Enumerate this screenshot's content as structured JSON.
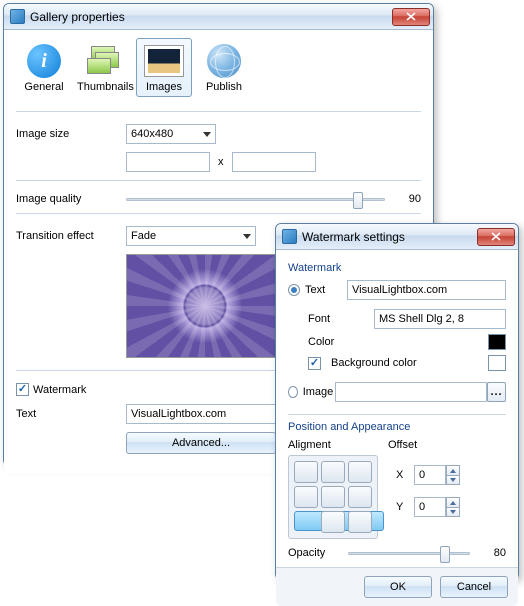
{
  "win1": {
    "title": "Gallery properties",
    "tabs": {
      "general": "General",
      "thumbnails": "Thumbnails",
      "images": "Images",
      "publish": "Publish"
    },
    "image_size_label": "Image size",
    "image_size_value": "640x480",
    "width_value": "",
    "height_value": "",
    "size_sep": "x",
    "quality_label": "Image quality",
    "quality_value": "90",
    "transition_label": "Transition effect",
    "transition_value": "Fade",
    "watermark_label": "Watermark",
    "text_label": "Text",
    "text_value": "VisualLightbox.com",
    "advanced_btn": "Advanced..."
  },
  "win2": {
    "title": "Watermark settings",
    "group_watermark": "Watermark",
    "radio_text": "Text",
    "text_value": "VisualLightbox.com",
    "font_label": "Font",
    "font_value": "MS Shell Dlg 2, 8",
    "color_label": "Color",
    "bgcolor_label": "Background color",
    "radio_image": "Image",
    "image_value": "",
    "group_pos": "Position and Appearance",
    "alignment_label": "Aligment",
    "offset_label": "Offset",
    "x_label": "X",
    "x_value": "0",
    "y_label": "Y",
    "y_value": "0",
    "opacity_label": "Opacity",
    "opacity_value": "80",
    "ok": "OK",
    "cancel": "Cancel",
    "color_swatch": "#000000",
    "bgcolor_swatch": "#ffffff"
  }
}
